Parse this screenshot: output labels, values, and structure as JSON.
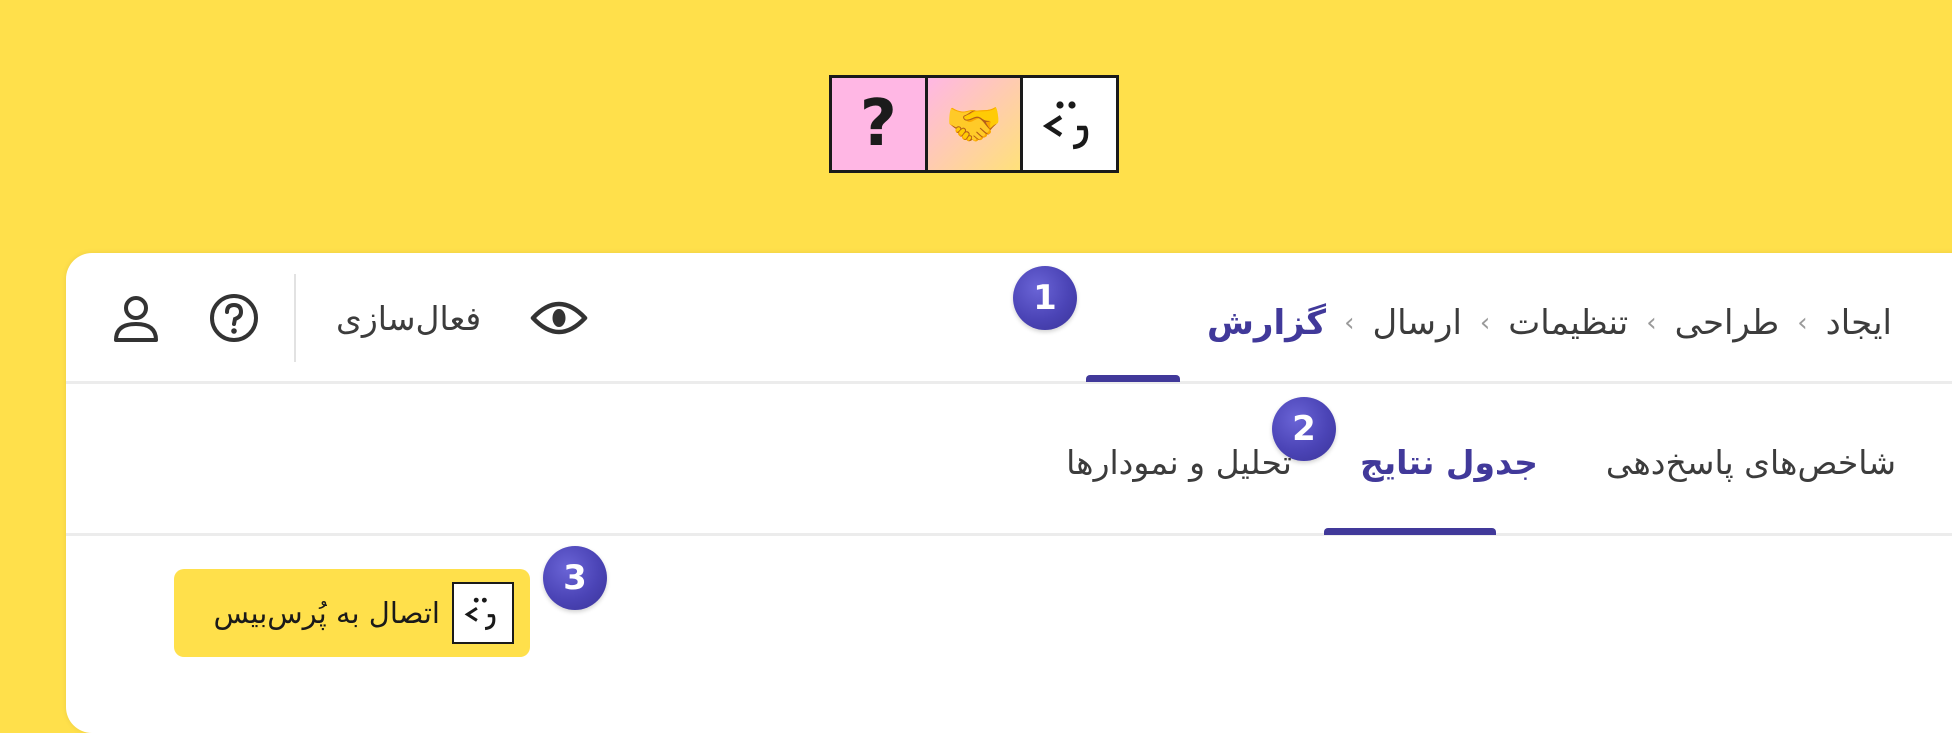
{
  "logo": {
    "tiles": [
      "question-tile",
      "handshake-tile",
      "porsbis-face-tile"
    ],
    "question_glyph": "?",
    "handshake_glyph": "🤝",
    "colors": {
      "pink": "#FFB7E4",
      "yellow": "#FFE17A"
    }
  },
  "workflow_steps": {
    "items": [
      {
        "label": "ایجاد",
        "active": false
      },
      {
        "label": "طراحی",
        "active": false
      },
      {
        "label": "تنظیمات",
        "active": false
      },
      {
        "label": "ارسال",
        "active": false
      },
      {
        "label": "گزارش",
        "active": true
      }
    ],
    "separator": "›"
  },
  "toolbar": {
    "activate_label": "فعال‌سازی",
    "icons": [
      "eye-icon",
      "help-icon",
      "user-icon"
    ]
  },
  "report_tabs": {
    "items": [
      {
        "label": "شاخص‌های پاسخ‌دهی",
        "active": false
      },
      {
        "label": "جدول نتایج",
        "active": true
      },
      {
        "label": "تحلیل و نمودارها",
        "active": false
      }
    ]
  },
  "connect_button": {
    "label": "اتصال به پُرس‌بیس"
  },
  "badges": [
    "1",
    "2",
    "3"
  ],
  "colors": {
    "background": "#FFE04B",
    "accent": "#41399A",
    "badge": "#4B44B6",
    "text": "#3C3C3C"
  }
}
